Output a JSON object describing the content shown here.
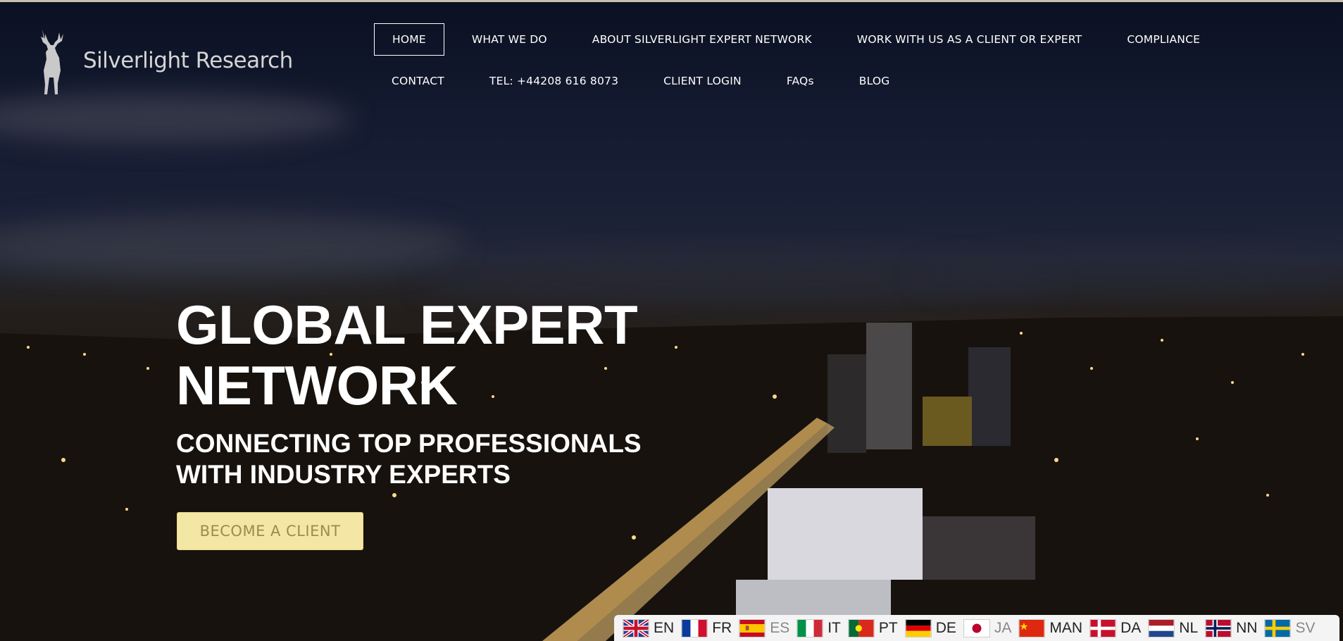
{
  "brand": {
    "name": "Silverlight Research"
  },
  "nav": {
    "row1": [
      "HOME",
      "WHAT WE DO",
      "ABOUT SILVERLIGHT EXPERT NETWORK",
      "WORK WITH US AS A CLIENT OR EXPERT",
      "COMPLIANCE"
    ],
    "row2": [
      "CONTACT",
      "TEL: +44208 616 8073",
      "CLIENT LOGIN",
      "FAQs",
      "BLOG"
    ],
    "active": "HOME"
  },
  "hero": {
    "headline_line1": "GLOBAL EXPERT",
    "headline_line2": "NETWORK",
    "subhead_line1": "CONNECTING TOP PROFESSIONALS",
    "subhead_line2": "WITH INDUSTRY EXPERTS",
    "cta_label": "BECOME A CLIENT"
  },
  "languages": [
    {
      "code": "EN",
      "flag": "uk-flag-icon"
    },
    {
      "code": "FR",
      "flag": "france-flag-icon"
    },
    {
      "code": "ES",
      "flag": "spain-flag-icon"
    },
    {
      "code": "IT",
      "flag": "italy-flag-icon"
    },
    {
      "code": "PT",
      "flag": "portugal-flag-icon"
    },
    {
      "code": "DE",
      "flag": "germany-flag-icon"
    },
    {
      "code": "JA",
      "flag": "japan-flag-icon"
    },
    {
      "code": "MAN",
      "flag": "china-flag-icon"
    },
    {
      "code": "DA",
      "flag": "denmark-flag-icon"
    },
    {
      "code": "NL",
      "flag": "netherlands-flag-icon"
    },
    {
      "code": "NN",
      "flag": "norway-flag-icon"
    },
    {
      "code": "SV",
      "flag": "sweden-flag-icon"
    }
  ],
  "colors": {
    "cta_bg": "#f4e7a5",
    "cta_text": "#9c8d48",
    "nav_text": "#ffffff",
    "sky": "#141a30"
  }
}
